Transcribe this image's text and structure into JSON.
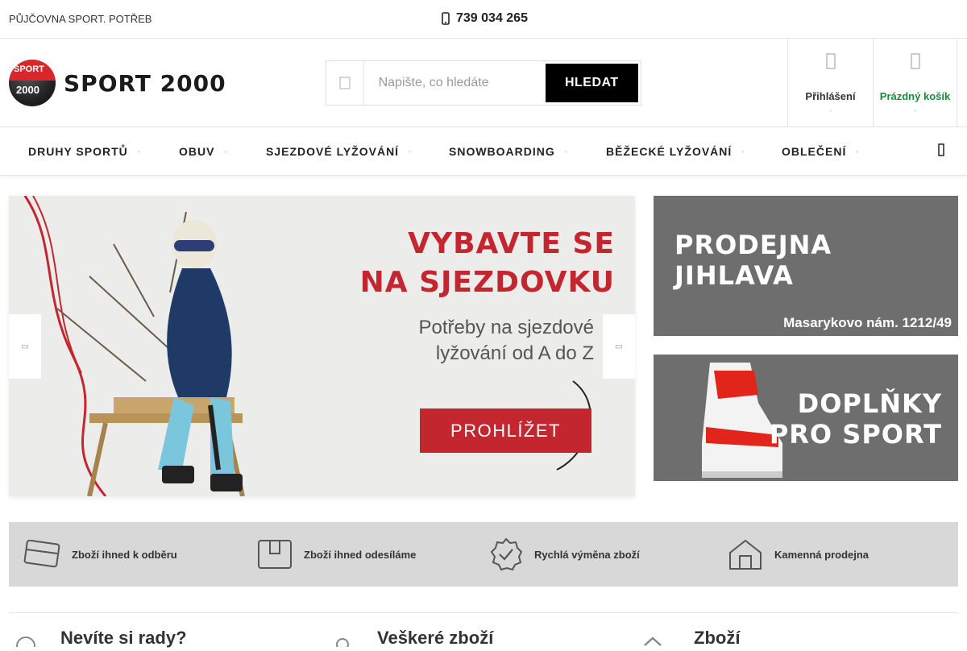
{
  "topbar": {
    "left_link": "PŮJČOVNA SPORT. POTŘEB",
    "phone": "739 034 265",
    "phone_icon": "phone-icon"
  },
  "logo": {
    "badge_top": "SPORT",
    "badge_bottom": "2000",
    "text": "SPORT 2000"
  },
  "search": {
    "placeholder": "Napište, co hledáte",
    "button": "HLEDAT",
    "icon": "search-icon"
  },
  "account": {
    "login": "Přihlášení",
    "cart": "Prázdný košík",
    "cart_color": "#1a8a3a"
  },
  "nav": {
    "items": [
      {
        "label": "DRUHY SPORTŮ"
      },
      {
        "label": "OBUV"
      },
      {
        "label": "SJEZDOVÉ LYŽOVÁNÍ"
      },
      {
        "label": "SNOWBOARDING"
      },
      {
        "label": "BĚŽECKÉ LYŽOVÁNÍ"
      },
      {
        "label": "OBLEČENÍ"
      }
    ]
  },
  "hero": {
    "title_line1": "VYBAVTE SE",
    "title_line2": "NA SJEZDOVKU",
    "sub_line1": "Potřeby na sjezdové",
    "sub_line2": "lyžování od A do Z",
    "cta": "PROHLÍŽET",
    "accent": "#c3262f"
  },
  "banners": {
    "store_line1": "PRODEJNA",
    "store_line2": "JIHLAVA",
    "store_address": "Masarykovo nám. 1212/49",
    "accessories_line1": "DOPLŇKY",
    "accessories_line2": "PRO SPORT"
  },
  "benefits": [
    {
      "label": "Zboží ihned k odběru",
      "icon": "card-icon"
    },
    {
      "label": "Zboží ihned odesíláme",
      "icon": "box-icon"
    },
    {
      "label": "Rychlá výměna zboží",
      "icon": "check-badge-icon"
    },
    {
      "label": "Kamenná prodejna",
      "icon": "store-icon"
    }
  ],
  "info": [
    {
      "label": "Nevíte si rady?"
    },
    {
      "label": "Veškeré zboží"
    },
    {
      "label": "Zboží"
    }
  ]
}
